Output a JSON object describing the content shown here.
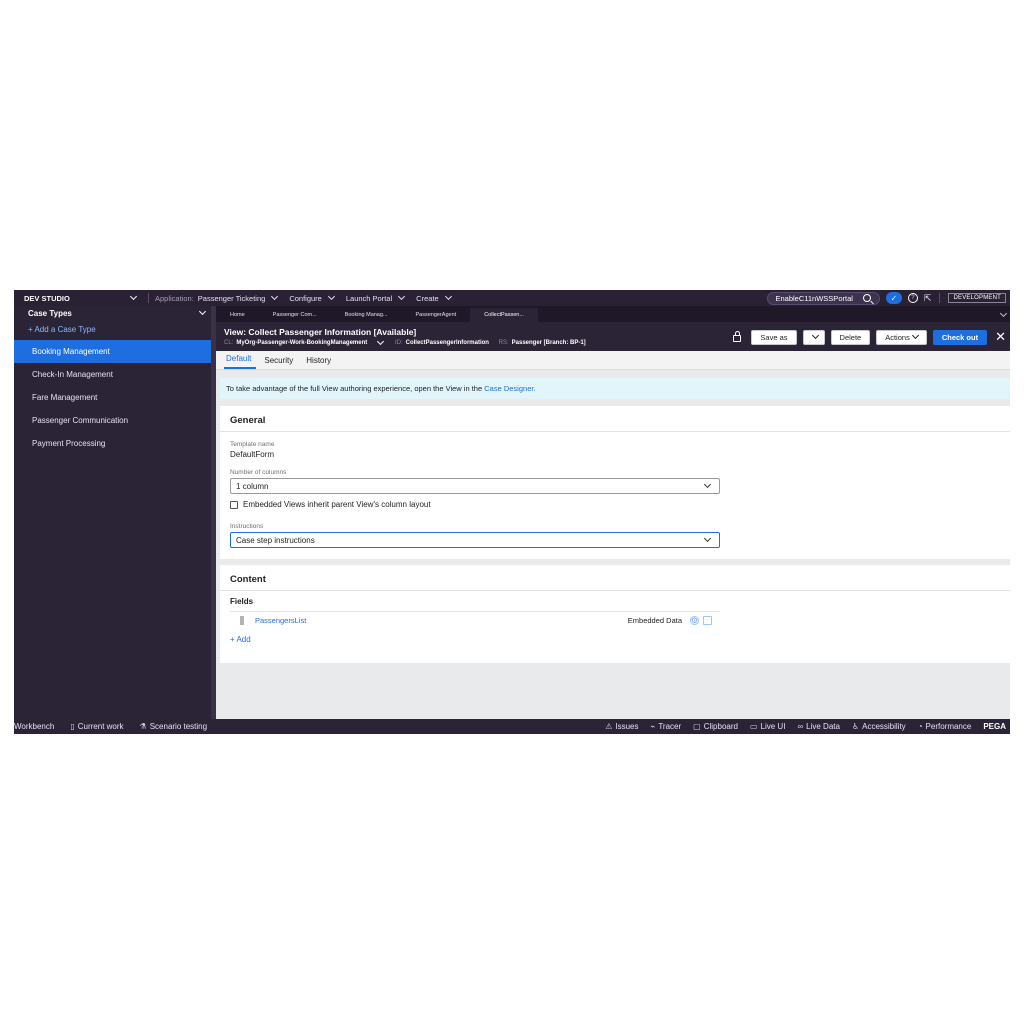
{
  "topbar": {
    "brand": "DEV STUDIO",
    "application_label": "Application:",
    "application_value": "Passenger Ticketing",
    "configure": "Configure",
    "launch_portal": "Launch Portal",
    "create": "Create",
    "portal_name": "EnableC11nWSSPortal",
    "environment_badge": "DEVELOPMENT"
  },
  "sidebar": {
    "title": "Case Types",
    "add_label": "+ Add a Case Type",
    "items": [
      {
        "label": "Booking Management",
        "active": true
      },
      {
        "label": "Check-In Management",
        "active": false
      },
      {
        "label": "Fare Management",
        "active": false
      },
      {
        "label": "Passenger Communication",
        "active": false
      },
      {
        "label": "Payment Processing",
        "active": false
      }
    ]
  },
  "tabs": [
    "Home",
    "Passenger Com...",
    "Booking Manag...",
    "PassengerAgent",
    "CollectPassen..."
  ],
  "header": {
    "title": "View: Collect Passenger Information [Available]",
    "cl_key": "CL:",
    "cl_value": "MyOrg-Passenger-Work-BookingManagement",
    "id_key": "ID:",
    "id_value": "CollectPassengerInformation",
    "rs_key": "RS:",
    "rs_value": "Passenger [Branch: BP-1]",
    "save_as": "Save as",
    "delete": "Delete",
    "actions": "Actions",
    "check_out": "Check out"
  },
  "subtabs": [
    "Default",
    "Security",
    "History"
  ],
  "notice": {
    "text": "To take advantage of the full View authoring experience, open the View in the",
    "link": "Case Designer."
  },
  "general": {
    "title": "General",
    "template_label": "Template name",
    "template_value": "DefaultForm",
    "columns_label": "Number of columns",
    "columns_value": "1 column",
    "checkbox_label": "Embedded Views inherit parent View's column layout",
    "instructions_label": "Instructions",
    "instructions_value": "Case step instructions"
  },
  "content": {
    "title": "Content",
    "fields_label": "Fields",
    "field_name": "PassengersList",
    "field_type": "Embedded Data",
    "add_label": "+ Add"
  },
  "statusbar": {
    "workbench": "Workbench",
    "current_work": "Current work",
    "scenario_testing": "Scenario testing",
    "issues": "Issues",
    "tracer": "Tracer",
    "clipboard": "Clipboard",
    "live_ui": "Live UI",
    "live_data": "Live Data",
    "accessibility": "Accessibility",
    "performance": "Performance",
    "pega": "PEGA"
  }
}
